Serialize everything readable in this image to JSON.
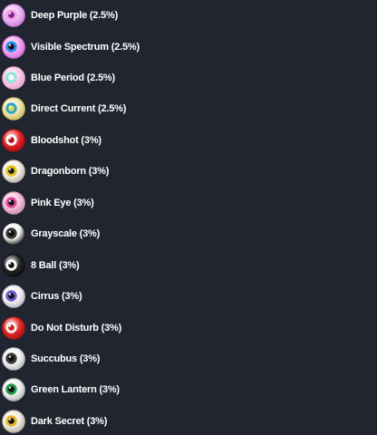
{
  "items": [
    {
      "label": "Deep Purple (2.5%)",
      "icon": "deep-purple-eye-icon",
      "sclera": "#e9b8f2",
      "iris": "#f5a3e6",
      "pupil": "#7a1f8c",
      "rim": "#c77ad9"
    },
    {
      "label": "Visible Spectrum (2.5%)",
      "icon": "visible-spectrum-eye-icon",
      "sclera": "#f3a7ee",
      "iris": "#2a8df0",
      "pupil": "#111111",
      "rim": "#d36bd9"
    },
    {
      "label": "Blue Period (2.5%)",
      "icon": "blue-period-eye-icon",
      "sclera": "#f7c9e8",
      "iris": "#8de6d6",
      "pupil": "#f3f3f3",
      "rim": "#e3a6cc"
    },
    {
      "label": "Direct Current (2.5%)",
      "icon": "direct-current-eye-icon",
      "sclera": "#f0e6b0",
      "iris": "#2aa6c9",
      "pupil": "#e8d84a",
      "rim": "#c9b85c"
    },
    {
      "label": "Bloodshot (3%)",
      "icon": "bloodshot-eye-icon",
      "sclera": "#e8262b",
      "iris": "#ffffff",
      "pupil": "#b30f16",
      "rim": "#9c0e12"
    },
    {
      "label": "Dragonborn (3%)",
      "icon": "dragonborn-eye-icon",
      "sclera": "#f5efe6",
      "iris": "#e3c21f",
      "pupil": "#1a1a1a",
      "rim": "#b9b2a6"
    },
    {
      "label": "Pink Eye (3%)",
      "icon": "pink-eye-icon",
      "sclera": "#f2c0da",
      "iris": "#e04a9b",
      "pupil": "#141414",
      "rim": "#c98db0"
    },
    {
      "label": "Grayscale (3%)",
      "icon": "grayscale-eye-icon",
      "sclera": "#f2f2f2",
      "iris": "#3a3a3a",
      "pupil": "#0a0a0a",
      "rim": "#1c1c1c"
    },
    {
      "label": "8 Ball (3%)",
      "icon": "eight-ball-eye-icon",
      "sclera": "#262626",
      "iris": "#ffffff",
      "pupil": "#111111",
      "rim": "#0d0d0d"
    },
    {
      "label": "Cirrus (3%)",
      "icon": "cirrus-eye-icon",
      "sclera": "#f4f1f5",
      "iris": "#6a5fd1",
      "pupil": "#121212",
      "rim": "#bdb8c7"
    },
    {
      "label": "Do Not Disturb (3%)",
      "icon": "do-not-disturb-eye-icon",
      "sclera": "#e62a2a",
      "iris": "#f2f2f2",
      "pupil": "#d11d1d",
      "rim": "#a11414"
    },
    {
      "label": "Succubus (3%)",
      "icon": "succubus-eye-icon",
      "sclera": "#f3f3f3",
      "iris": "#3b3b3b",
      "pupil": "#0c0c0c",
      "rim": "#b8b8b8"
    },
    {
      "label": "Green Lantern (3%)",
      "icon": "green-lantern-eye-icon",
      "sclera": "#f2f2f2",
      "iris": "#1f9a46",
      "pupil": "#0c0c0c",
      "rim": "#b4b4b4"
    },
    {
      "label": "Dark Secret (3%)",
      "icon": "dark-secret-eye-icon",
      "sclera": "#f1ede4",
      "iris": "#e2b62a",
      "pupil": "#111111",
      "rim": "#b7ae9c"
    }
  ]
}
